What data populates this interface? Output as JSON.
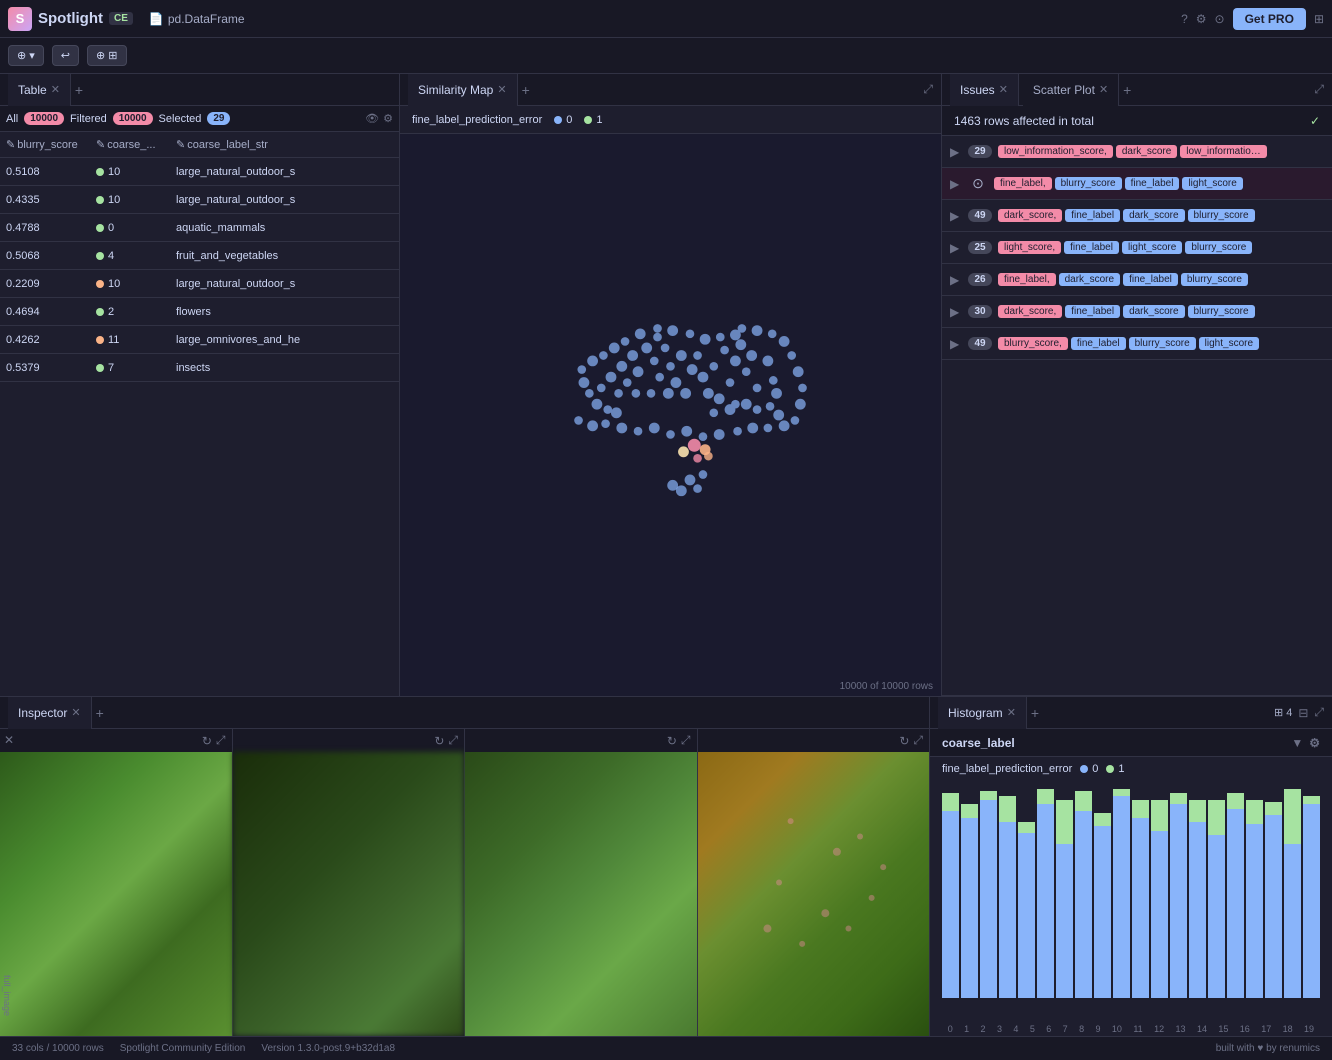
{
  "app": {
    "name": "Spotlight",
    "edition": "CE",
    "file": "pd.DataFrame"
  },
  "topbar": {
    "get_pro": "Get PRO",
    "icons": [
      "help",
      "settings",
      "github"
    ]
  },
  "toolbar": {
    "filter_btn": "⊕ ▾",
    "undo_btn": "↩",
    "add_widget_btn": "⊕ ⊞"
  },
  "table": {
    "title": "Table",
    "all_count": "10000",
    "filtered_count": "10000",
    "selected_count": "29",
    "columns": [
      "blurry_score",
      "coarse_...",
      "coarse_label_str"
    ],
    "rows": [
      {
        "blurry": "0.5108",
        "coarse": "10",
        "dot": "green",
        "label": "large_natural_outdoor_s"
      },
      {
        "blurry": "0.4335",
        "coarse": "10",
        "dot": "green",
        "label": "large_natural_outdoor_s"
      },
      {
        "blurry": "0.4788",
        "coarse": "0",
        "dot": "green",
        "label": "aquatic_mammals"
      },
      {
        "blurry": "0.5068",
        "coarse": "4",
        "dot": "green",
        "label": "fruit_and_vegetables"
      },
      {
        "blurry": "0.2209",
        "coarse": "10",
        "dot": "orange",
        "label": "large_natural_outdoor_s"
      },
      {
        "blurry": "0.4694",
        "coarse": "2",
        "dot": "green",
        "label": "flowers"
      },
      {
        "blurry": "0.4262",
        "coarse": "11",
        "dot": "orange",
        "label": "large_omnivores_and_he"
      },
      {
        "blurry": "0.5379",
        "coarse": "7",
        "dot": "green",
        "label": "insects"
      }
    ]
  },
  "similarity_map": {
    "title": "Similarity Map",
    "legend": [
      "0",
      "1"
    ],
    "footer": "10000 of 10000 rows",
    "metric": "fine_label_prediction_error"
  },
  "issues": {
    "title": "Issues",
    "scatter_title": "Scatter Plot",
    "affected": "1463 rows affected in total",
    "rows": [
      {
        "count": "29",
        "tags": [
          "low_information_score,",
          "dark_score",
          "low_informatio…"
        ],
        "tag_colors": [
          "red",
          "red",
          "red"
        ],
        "active": false
      },
      {
        "count": "",
        "tags": [
          "fine_label,",
          "blurry_score",
          "fine_label",
          "light_score"
        ],
        "tag_colors": [
          "red",
          "blue",
          "blue",
          "blue"
        ],
        "active": true
      },
      {
        "count": "49",
        "tags": [
          "dark_score,",
          "fine_label",
          "dark_score",
          "blurry_score"
        ],
        "tag_colors": [
          "red",
          "blue",
          "blue",
          "blue"
        ],
        "active": false
      },
      {
        "count": "25",
        "tags": [
          "light_score,",
          "fine_label",
          "light_score",
          "blurry_score"
        ],
        "tag_colors": [
          "red",
          "blue",
          "blue",
          "blue"
        ],
        "active": false
      },
      {
        "count": "26",
        "tags": [
          "fine_label,",
          "dark_score",
          "fine_label",
          "blurry_score"
        ],
        "tag_colors": [
          "red",
          "blue",
          "blue",
          "blue"
        ],
        "active": false
      },
      {
        "count": "30",
        "tags": [
          "dark_score,",
          "fine_label",
          "dark_score",
          "blurry_score"
        ],
        "tag_colors": [
          "red",
          "blue",
          "blue",
          "blue"
        ],
        "active": false
      },
      {
        "count": "49",
        "tags": [
          "blurry_score,",
          "fine_label",
          "blurry_score",
          "light_score"
        ],
        "tag_colors": [
          "red",
          "blue",
          "blue",
          "blue"
        ],
        "active": false
      }
    ]
  },
  "inspector": {
    "title": "Inspector"
  },
  "histogram": {
    "title": "Histogram",
    "metric": "coarse_label",
    "filter_metric": "fine_label_prediction_error",
    "legend_0": "0",
    "legend_1": "1",
    "bars": [
      {
        "blue": 85,
        "green": 8
      },
      {
        "blue": 82,
        "green": 6
      },
      {
        "blue": 90,
        "green": 4
      },
      {
        "blue": 80,
        "green": 12
      },
      {
        "blue": 75,
        "green": 5
      },
      {
        "blue": 88,
        "green": 7
      },
      {
        "blue": 70,
        "green": 20
      },
      {
        "blue": 85,
        "green": 9
      },
      {
        "blue": 78,
        "green": 6
      },
      {
        "blue": 92,
        "green": 3
      },
      {
        "blue": 82,
        "green": 8
      },
      {
        "blue": 76,
        "green": 14
      },
      {
        "blue": 88,
        "green": 5
      },
      {
        "blue": 80,
        "green": 10
      },
      {
        "blue": 74,
        "green": 16
      },
      {
        "blue": 86,
        "green": 7
      },
      {
        "blue": 79,
        "green": 11
      },
      {
        "blue": 83,
        "green": 6
      },
      {
        "blue": 70,
        "green": 25
      },
      {
        "blue": 88,
        "green": 4
      }
    ],
    "x_labels": [
      "0",
      "1",
      "2",
      "3",
      "4",
      "5",
      "6",
      "7",
      "8",
      "9",
      "10",
      "11",
      "12",
      "13",
      "14",
      "15",
      "16",
      "17",
      "18",
      "19"
    ]
  },
  "statusbar": {
    "cols": "33 cols / 10000 rows",
    "edition": "Spotlight Community Edition",
    "version": "Version 1.3.0-post.9+b32d1a8",
    "built_with": "built with ♥ by renumics"
  }
}
